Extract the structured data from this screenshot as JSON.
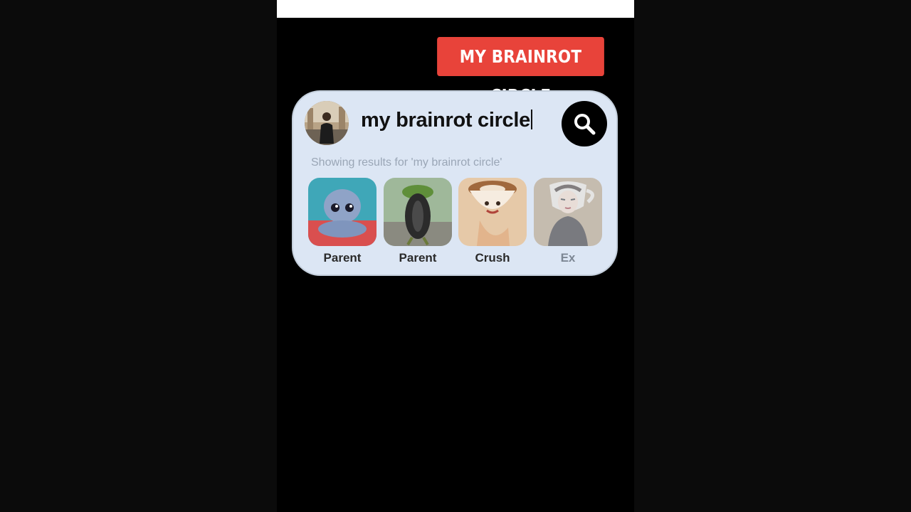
{
  "banner": {
    "text": "MY BRAINROT CIRCLE"
  },
  "search": {
    "query": "my brainrot circle",
    "results_caption": "Showing results for 'my brainrot circle'"
  },
  "icons": {
    "avatar": "profile-photo",
    "search": "search-icon"
  },
  "results": [
    {
      "label": "Parent",
      "icon": "octopus-character-image"
    },
    {
      "label": "Parent",
      "icon": "frog-tire-character-image"
    },
    {
      "label": "Crush",
      "icon": "coffee-cup-character-image"
    },
    {
      "label": "Ex",
      "icon": "teacup-woman-character-image"
    }
  ],
  "colors": {
    "banner": "#e8433a",
    "card": "#dce6f4",
    "search_button": "#000000"
  }
}
